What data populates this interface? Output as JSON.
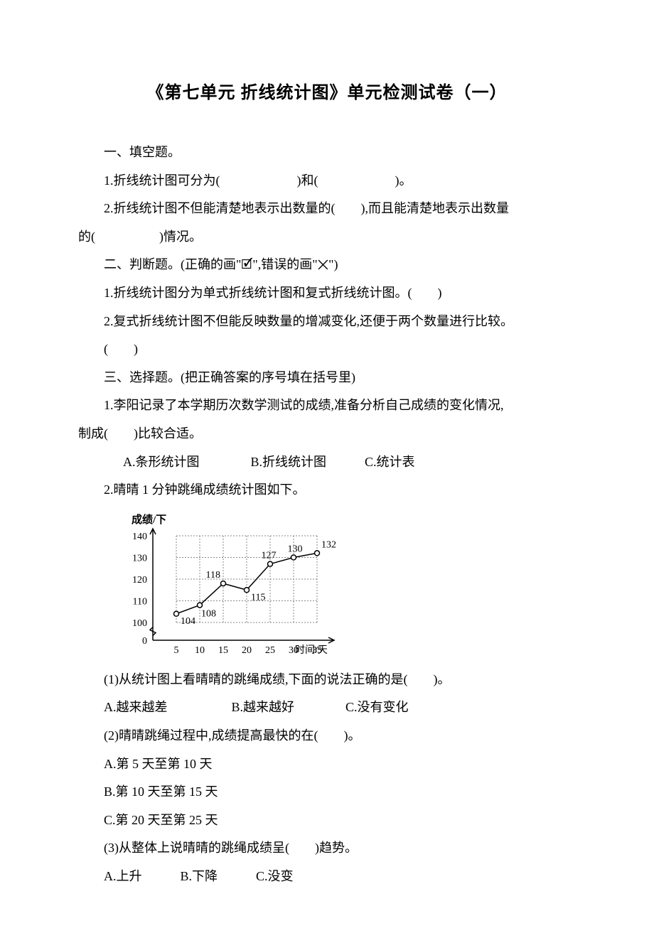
{
  "title": "《第七单元 折线统计图》单元检测试卷（一）",
  "s1": {
    "heading": "一、填空题。",
    "q1": "1.折线统计图可分为(　　　　　　)和(　　　　　　)。",
    "q2a": "2.折线统计图不但能清楚地表示出数量的(　　),而且能清楚地表示出数量",
    "q2b": "的(　　　　　)情况。"
  },
  "s2": {
    "heading": "二、判断题。(正确的画\"🗹\",错误的画\"✕\")",
    "q1": "1.折线统计图分为单式折线统计图和复式折线统计图。(　　)",
    "q2": "2.复式折线统计图不但能反映数量的增减变化,还便于两个数量进行比较。",
    "q2b": "(　　)"
  },
  "s3": {
    "heading": "三、选择题。(把正确答案的序号填在括号里)",
    "q1a": "1.李阳记录了本学期历次数学测试的成绩,准备分析自己成绩的变化情况,",
    "q1b": "制成(　　)比较合适。",
    "q1opts": "A.条形统计图　　　　B.折线统计图　　　C.统计表",
    "q2": "2.晴晴 1 分钟跳绳成绩统计图如下。",
    "sub1": "(1)从统计图上看晴晴的跳绳成绩,下面的说法正确的是(　　)。",
    "sub1opts": "A.越来越差　　　　　B.越来越好　　　　C.没有变化",
    "sub2": "(2)晴晴跳绳过程中,成绩提高最快的在(　　)。",
    "sub2a": "A.第 5 天至第 10 天",
    "sub2b": "B.第 10 天至第 15 天",
    "sub2c": "C.第 20 天至第 25 天",
    "sub3": "(3)从整体上说晴晴的跳绳成绩呈(　　)趋势。",
    "sub3opts": "A.上升　　　B.下降　　　C.没变"
  },
  "chart_data": {
    "type": "line",
    "title": "",
    "ylabel": "成绩/下",
    "xlabel": "时间/天",
    "x": [
      5,
      10,
      15,
      20,
      25,
      30,
      35
    ],
    "values": [
      104,
      108,
      118,
      115,
      127,
      130,
      132
    ],
    "y_ticks": [
      0,
      100,
      110,
      120,
      130,
      140
    ],
    "x_ticks": [
      5,
      10,
      15,
      20,
      25,
      30,
      35
    ],
    "y_break": true
  }
}
